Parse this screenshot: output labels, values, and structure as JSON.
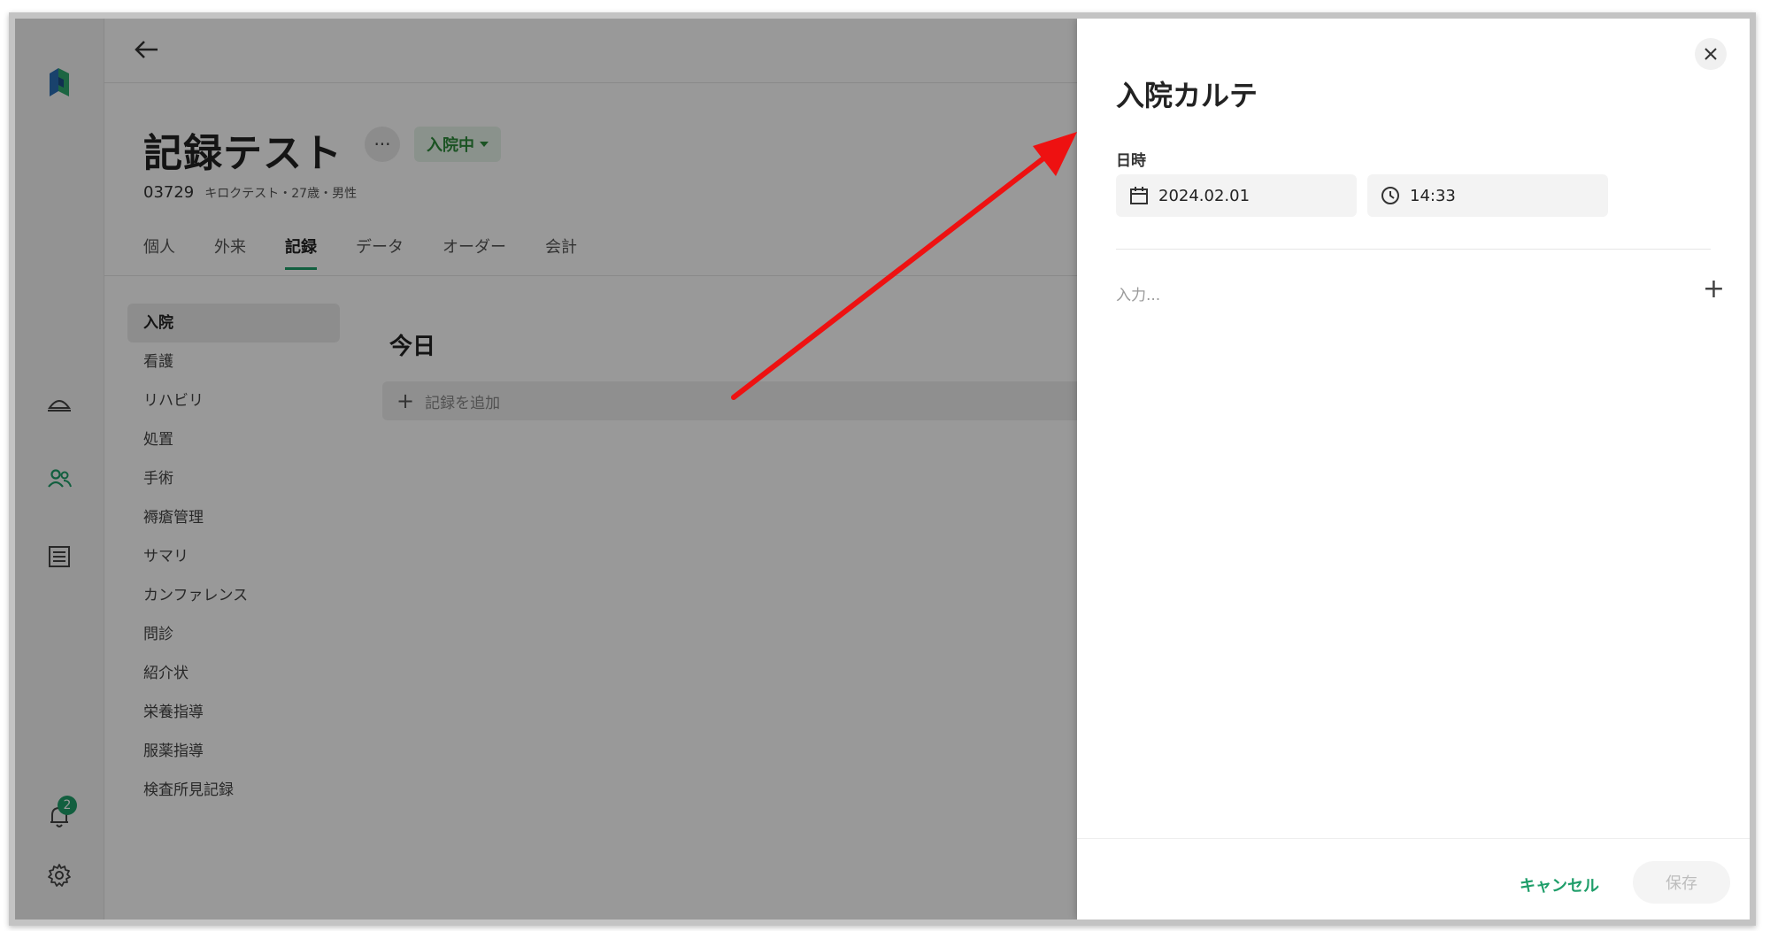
{
  "patient": {
    "name": "記録テスト",
    "status": "入院中",
    "more": "···",
    "id": "03729",
    "details": "キロクテスト・27歳・男性"
  },
  "tabs": [
    "個人",
    "外来",
    "記録",
    "データ",
    "オーダー",
    "会計"
  ],
  "active_tab": "記録",
  "categories": [
    "入院",
    "看護",
    "リハビリ",
    "処置",
    "手術",
    "褥瘡管理",
    "サマリ",
    "カンファレンス",
    "問診",
    "紹介状",
    "栄養指導",
    "服薬指導",
    "検査所見記録"
  ],
  "content": {
    "today": "今日",
    "add_record": "記録を追加"
  },
  "rail": {
    "badge": "2"
  },
  "panel": {
    "title": "入院カルテ",
    "datetime_label": "日時",
    "date": "2024.02.01",
    "time": "14:33",
    "input_placeholder": "入力...",
    "cancel": "キャンセル",
    "save": "保存"
  },
  "colors": {
    "accent": "#1f9e6a",
    "status_bg": "#e7f3ea",
    "arrow": "#ee1111"
  }
}
